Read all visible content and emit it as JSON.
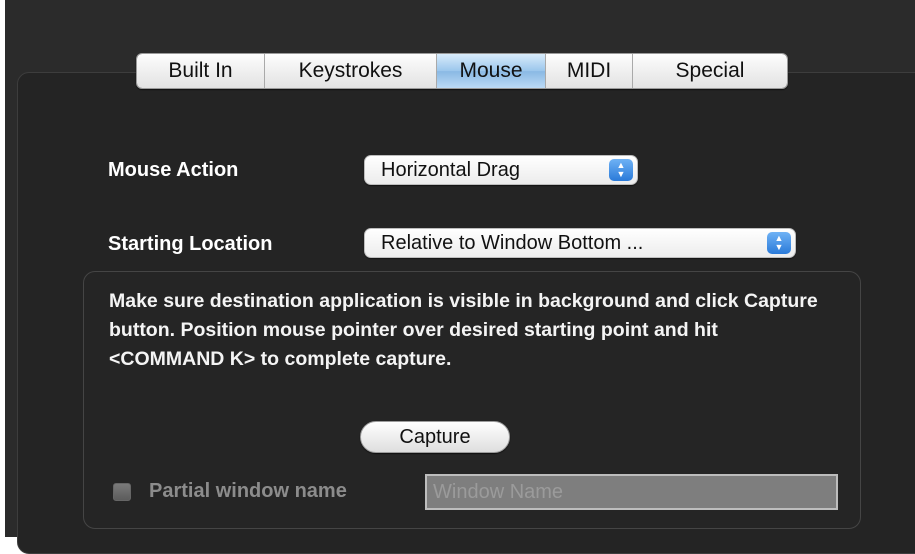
{
  "tabs": [
    {
      "label": "Built In",
      "selected": false
    },
    {
      "label": "Keystrokes",
      "selected": false
    },
    {
      "label": "Mouse",
      "selected": true
    },
    {
      "label": "MIDI",
      "selected": false
    },
    {
      "label": "Special",
      "selected": false
    }
  ],
  "mouse_action": {
    "label": "Mouse Action",
    "value": "Horizontal Drag"
  },
  "starting_location": {
    "label": "Starting Location",
    "value": "Relative to Window Bottom ..."
  },
  "instructions": "Make sure destination application is visible in background and click Capture button. Position mouse pointer over desired starting point and hit <COMMAND K> to complete capture.",
  "capture_button": "Capture",
  "partial_window": {
    "label": "Partial window name",
    "checked": false,
    "placeholder": "Window Name"
  },
  "colors": {
    "background": "#2b2b2b",
    "selected_tab": "#9bc6ec",
    "popup_arrow": "#2a7ad9"
  }
}
